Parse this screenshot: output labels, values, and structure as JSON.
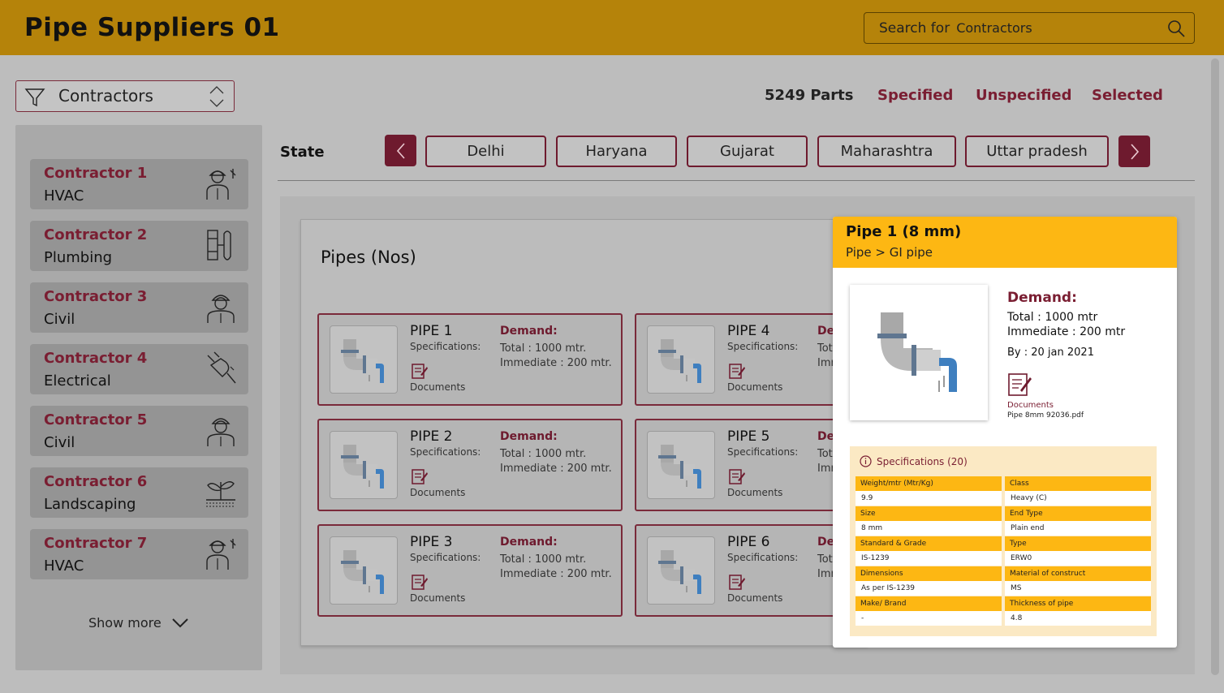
{
  "header": {
    "title": "Pipe Suppliers 01",
    "search_prefix": "Search for",
    "search_value": "Contractors"
  },
  "filter": {
    "label": "Contractors"
  },
  "stats": {
    "count": "5249 Parts",
    "specified": "Specified",
    "unspecified": "Unspecified",
    "selected": "Selected"
  },
  "contractors": [
    {
      "name": "Contractor 1",
      "type": "HVAC",
      "icon": "hvac-worker-icon"
    },
    {
      "name": "Contractor 2",
      "type": "Plumbing",
      "icon": "plumbing-tools-icon"
    },
    {
      "name": "Contractor 3",
      "type": "Civil",
      "icon": "civil-worker-icon"
    },
    {
      "name": "Contractor 4",
      "type": "Electrical",
      "icon": "electrical-plug-icon"
    },
    {
      "name": "Contractor 5",
      "type": "Civil",
      "icon": "civil-worker-icon"
    },
    {
      "name": "Contractor 6",
      "type": "Landscaping",
      "icon": "landscaping-plant-icon"
    },
    {
      "name": "Contractor 7",
      "type": "HVAC",
      "icon": "hvac-worker-icon"
    }
  ],
  "show_more": "Show more",
  "state": {
    "label": "State",
    "chips": [
      "Delhi",
      "Haryana",
      "Gujarat",
      "Maharashtra",
      "Uttar pradesh"
    ]
  },
  "pipes": {
    "title": "Pipes (Nos)",
    "spec_label": "Specifications:",
    "doc_label": "Documents",
    "demand_label": "Demand:",
    "items": [
      {
        "name": "PIPE 1",
        "total": "Total : 1000 mtr.",
        "immediate": "Immediate : 200 mtr."
      },
      {
        "name": "PIPE 2",
        "total": "Total : 1000 mtr.",
        "immediate": "Immediate : 200 mtr."
      },
      {
        "name": "PIPE 3",
        "total": "Total : 1000 mtr.",
        "immediate": "Immediate : 200 mtr."
      },
      {
        "name": "PIPE 4",
        "total": "Tot",
        "immediate": "Imm",
        "demand": "De"
      },
      {
        "name": "PIPE 5",
        "total": "Tot",
        "immediate": "Imm",
        "demand": "De"
      },
      {
        "name": "PIPE 6",
        "total": "Tot",
        "immediate": "Imm",
        "demand": "De"
      }
    ]
  },
  "detail": {
    "title": "Pipe 1 (8 mm)",
    "breadcrumb": "Pipe > GI pipe",
    "demand_label": "Demand:",
    "total": "Total : 1000 mtr",
    "immediate": "Immediate : 200 mtr",
    "by": "By : 20 jan 2021",
    "doc_label": "Documents",
    "doc_file": "Pipe 8mm 92036.pdf",
    "spec_title": "Specifications (20)",
    "specs": [
      [
        {
          "k": "Weight/mtr (Mtr/Kg)",
          "v": "9.9"
        },
        {
          "k": "Class",
          "v": "Heavy (C)"
        }
      ],
      [
        {
          "k": "Size",
          "v": "8 mm"
        },
        {
          "k": "End Type",
          "v": "Plain end"
        }
      ],
      [
        {
          "k": "Standard & Grade",
          "v": "IS-1239"
        },
        {
          "k": "Type",
          "v": "ERW0"
        }
      ],
      [
        {
          "k": "Dimensions",
          "v": "As per IS-1239"
        },
        {
          "k": "Material of construct",
          "v": "MS"
        }
      ],
      [
        {
          "k": "Make/ Brand",
          "v": "-"
        },
        {
          "k": "Thickness of pipe",
          "v": "4.8"
        }
      ]
    ]
  },
  "colors": {
    "header": "#b5830a",
    "accent": "#6e1a2e",
    "highlight": "#fdb713"
  }
}
